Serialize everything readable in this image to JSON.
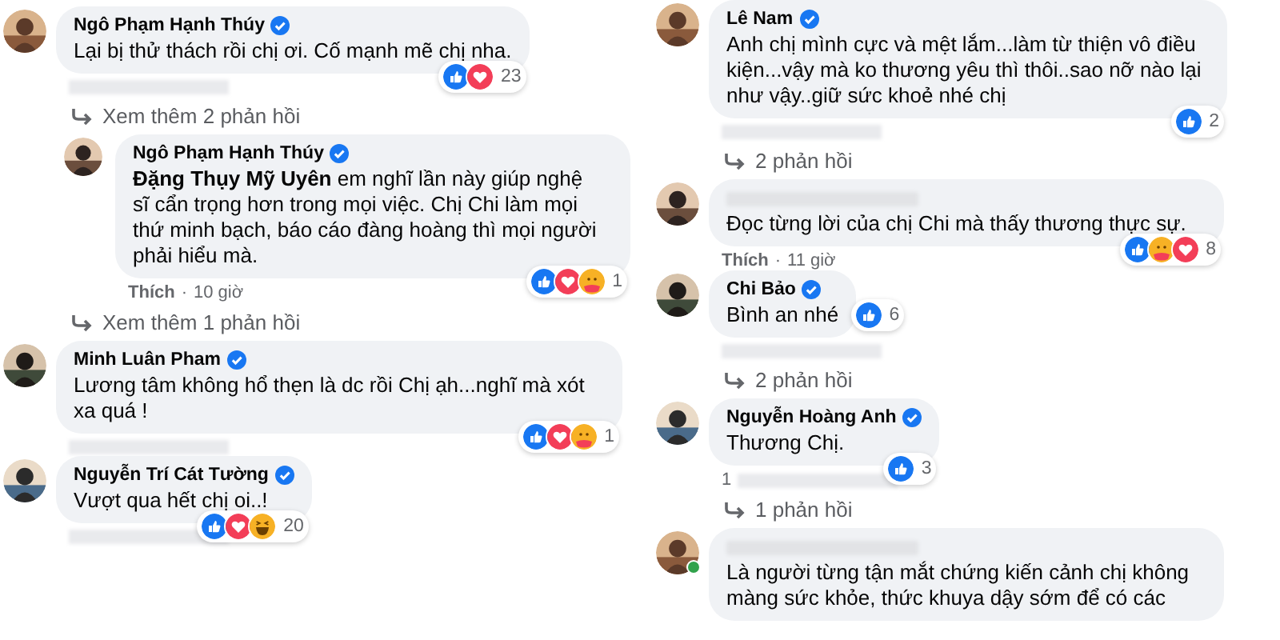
{
  "columns": [
    {
      "items": [
        {
          "kind": "comment",
          "reply": false,
          "name": "Ngô Phạm Hạnh Thúy",
          "verified": true,
          "text": "Lại bị thử thách rồi chị ơi. Cố mạnh mẽ chị nha.",
          "reactions": [
            {
              "kind": "like"
            },
            {
              "kind": "love"
            }
          ],
          "count": "23",
          "meta_hidden": true
        },
        {
          "kind": "replies_link",
          "text": "Xem thêm 2 phản hồi"
        },
        {
          "kind": "comment",
          "reply": true,
          "name": "Ngô Phạm Hạnh Thúy",
          "verified": true,
          "text": "**Đặng Thụy Mỹ Uyên** em nghĩ lần này giúp nghệ sĩ cẩn trọng hơn trong mọi việc. Chị Chi làm mọi thứ minh bạch, báo cáo đàng hoàng thì mọi người phải hiểu mà.",
          "reactions": [
            {
              "kind": "like"
            },
            {
              "kind": "love"
            },
            {
              "kind": "care"
            }
          ],
          "count": "1",
          "meta": {
            "like": "Thích",
            "separator": "·",
            "time": "10 giờ"
          }
        },
        {
          "kind": "replies_link",
          "text": "Xem thêm 1 phản hồi"
        },
        {
          "kind": "comment",
          "reply": false,
          "name": "Minh Luân Pham",
          "verified": true,
          "text": "Lương tâm không hổ thẹn là dc rồi Chị ạh...nghĩ mà xót xa quá !",
          "reactions": [
            {
              "kind": "like"
            },
            {
              "kind": "love"
            },
            {
              "kind": "care"
            }
          ],
          "count": "1",
          "meta_hidden": true
        },
        {
          "kind": "comment",
          "reply": false,
          "name": "Nguyễn Trí Cát Tường",
          "verified": true,
          "text": "Vượt qua hết chị oi..!",
          "reactions": [
            {
              "kind": "like"
            },
            {
              "kind": "love"
            },
            {
              "kind": "haha"
            }
          ],
          "count": "20",
          "meta_hidden": true
        }
      ]
    },
    {
      "items": [
        {
          "kind": "comment",
          "reply": false,
          "name": "Lê Nam",
          "verified": true,
          "text": "Anh chị mình cực và mệt lắm...làm từ thiện vô điều kiện...vậy mà ko thương yêu thì thôi..sao nỡ nào lại như vậy..giữ sức khoẻ nhé chị",
          "reactions": [
            {
              "kind": "like"
            }
          ],
          "count": "2",
          "meta_hidden": true
        },
        {
          "kind": "replies_link",
          "text": "2 phản hồi"
        },
        {
          "kind": "comment",
          "reply": false,
          "name_hidden": true,
          "text": "Đọc từng lời của chị Chi mà thấy thương thực sự.",
          "reactions": [
            {
              "kind": "like"
            },
            {
              "kind": "care"
            },
            {
              "kind": "love"
            }
          ],
          "count": "8",
          "meta": {
            "like": "Thích",
            "separator": "·",
            "time": "11 giờ"
          }
        },
        {
          "kind": "comment",
          "reply": false,
          "name": "Chi Bảo",
          "verified": true,
          "text": "Bình an nhé",
          "reactions": [
            {
              "kind": "like"
            }
          ],
          "count": "6",
          "meta_hidden": true
        },
        {
          "kind": "replies_link",
          "text": "2 phản hồi"
        },
        {
          "kind": "comment",
          "reply": false,
          "name": "Nguyễn Hoàng Anh",
          "verified": true,
          "text": "Thương Chị.",
          "reactions": [
            {
              "kind": "like"
            }
          ],
          "count": "3",
          "meta_prefix": "1",
          "meta_hidden": true
        },
        {
          "kind": "replies_link",
          "text": "1 phản hồi"
        },
        {
          "kind": "comment",
          "reply": false,
          "name_hidden": true,
          "online": true,
          "text": "Là người từng tận mắt chứng kiến cảnh chị không màng sức khỏe, thức khuya dậy sớm để có các"
        }
      ]
    }
  ]
}
